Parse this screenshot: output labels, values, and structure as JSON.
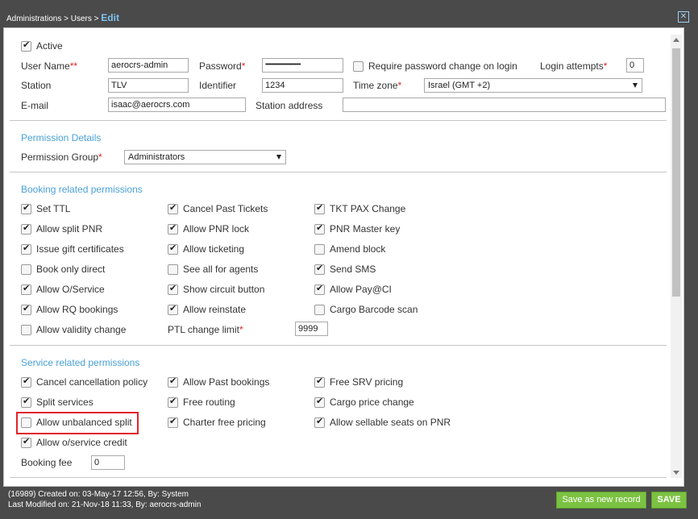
{
  "header": {
    "breadcrumb": "Administrations > Users >",
    "current": "Edit"
  },
  "form": {
    "active_label": "Active",
    "username_label": "User Name",
    "username_required": "**",
    "username_value": "aerocrs-admin",
    "password_label": "Password",
    "password_required": "*",
    "password_value": "••••••••••••••••••••••••••••••",
    "require_pw_change_label": "Require password change on login",
    "login_attempts_label": "Login attempts",
    "login_attempts_required": "*",
    "login_attempts_value": "0",
    "station_label": "Station",
    "station_value": "TLV",
    "identifier_label": "Identifier",
    "identifier_value": "1234",
    "timezone_label": "Time zone",
    "timezone_required": "*",
    "timezone_value": "Israel (GMT +2)",
    "email_label": "E-mail",
    "email_value": "isaac@aerocrs.com",
    "station_address_label": "Station address",
    "station_address_value": ""
  },
  "permission_details": {
    "title": "Permission Details",
    "group_label": "Permission Group",
    "group_required": "*",
    "group_value": "Administrators"
  },
  "booking": {
    "title": "Booking related permissions",
    "items": [
      {
        "label": "Set TTL",
        "checked": true
      },
      {
        "label": "Cancel Past Tickets",
        "checked": true
      },
      {
        "label": "TKT PAX Change",
        "checked": true
      },
      {
        "label": "Allow split PNR",
        "checked": true
      },
      {
        "label": "Allow PNR lock",
        "checked": true
      },
      {
        "label": "PNR Master key",
        "checked": true
      },
      {
        "label": "Issue gift certificates",
        "checked": true
      },
      {
        "label": "Allow ticketing",
        "checked": true
      },
      {
        "label": "Amend block",
        "checked": false
      },
      {
        "label": "Book only direct",
        "checked": false
      },
      {
        "label": "See all for agents",
        "checked": false
      },
      {
        "label": "Send SMS",
        "checked": true
      },
      {
        "label": "Allow O/Service",
        "checked": true
      },
      {
        "label": "Show circuit button",
        "checked": true
      },
      {
        "label": "Allow Pay@CI",
        "checked": true
      },
      {
        "label": "Allow RQ bookings",
        "checked": true
      },
      {
        "label": "Allow reinstate",
        "checked": true
      },
      {
        "label": "Cargo Barcode scan",
        "checked": false
      },
      {
        "label": "Allow validity change",
        "checked": false
      }
    ],
    "ptl_label": "PTL change limit",
    "ptl_required": "*",
    "ptl_value": "9999"
  },
  "service": {
    "title": "Service related permissions",
    "items": [
      {
        "label": "Cancel cancellation policy",
        "checked": true
      },
      {
        "label": "Allow Past bookings",
        "checked": true
      },
      {
        "label": "Free SRV pricing",
        "checked": true
      },
      {
        "label": "Split services",
        "checked": true
      },
      {
        "label": "Free routing",
        "checked": true
      },
      {
        "label": "Cargo price change",
        "checked": true
      },
      {
        "label": "Allow unbalanced split",
        "checked": false
      },
      {
        "label": "Charter free pricing",
        "checked": true
      },
      {
        "label": "Allow sellable seats on PNR",
        "checked": true
      },
      {
        "label": "Allow o/service credit",
        "checked": true
      }
    ],
    "booking_fee_label": "Booking fee",
    "booking_fee_value": "0"
  },
  "footer": {
    "created": "(16989) Created on: 03-May-17 12:56, By: System",
    "modified": "Last Modified on: 21-Nov-18 11:33, By: aerocrs-admin",
    "save_new_label": "Save as new record",
    "save_label": "SAVE"
  },
  "colors": {
    "accent": "#4aa0d8",
    "required": "#e02424",
    "button_green": "#7cc242",
    "highlight": "#e3232b"
  }
}
